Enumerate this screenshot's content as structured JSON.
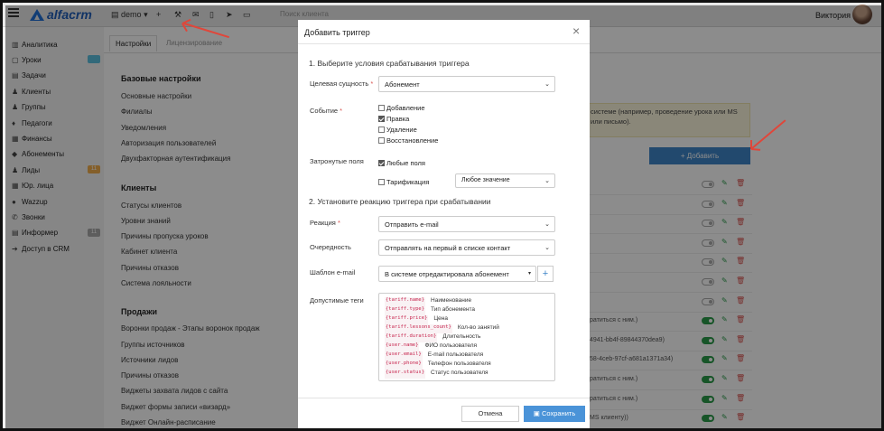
{
  "topbar": {
    "logo_text": "alfacrm",
    "branch": "demo",
    "search_placeholder": "Поиск клиента",
    "user_name": "Виктория"
  },
  "sidebar": {
    "items": [
      {
        "label": "Аналитика",
        "icon": "chart-icon"
      },
      {
        "label": "Уроки",
        "icon": "calendar-icon",
        "badge": "",
        "badge_color": "#5bc0de"
      },
      {
        "label": "Задачи",
        "icon": "tasks-icon"
      },
      {
        "label": "Клиенты",
        "icon": "user-icon"
      },
      {
        "label": "Группы",
        "icon": "users-icon"
      },
      {
        "label": "Педагоги",
        "icon": "graduation-icon"
      },
      {
        "label": "Финансы",
        "icon": "finance-icon"
      },
      {
        "label": "Абонементы",
        "icon": "tag-icon"
      },
      {
        "label": "Лиды",
        "icon": "lead-icon",
        "badge": "11",
        "badge_color": "#f0ad4e"
      },
      {
        "label": "Юр. лица",
        "icon": "building-icon"
      },
      {
        "label": "Wazzup",
        "icon": "whatsapp-icon"
      },
      {
        "label": "Звонки",
        "icon": "phone-icon"
      },
      {
        "label": "Информер",
        "icon": "informer-icon",
        "badge": "11",
        "badge_color": "#aaaaaa"
      },
      {
        "label": "Доступ в CRM",
        "icon": "login-icon"
      }
    ]
  },
  "settings": {
    "tabs": [
      "Настройки",
      "Лицензирование"
    ],
    "sections": [
      {
        "title": "Базовые настройки",
        "items": [
          "Основные настройки",
          "Филиалы",
          "Уведомления",
          "Авторизация пользователей",
          "Двухфакторная аутентификация"
        ]
      },
      {
        "title": "Клиенты",
        "items": [
          "Статусы клиентов",
          "Уровни знаний",
          "Причины пропуска уроков",
          "Кабинет клиента",
          "Причины отказов",
          "Система лояльности"
        ]
      },
      {
        "title": "Продажи",
        "items": [
          "Воронки продаж - Этапы воронок продаж",
          "Группы источников",
          "Источники лидов",
          "Причины отказов",
          "Виджеты захвата лидов с сайта",
          "Виджет формы записи «визард»",
          "Виджет Онлайн-расписание"
        ]
      }
    ],
    "info_text": "системе (например, проведение урока или МS или письмо).",
    "add_button": "+ Добавить",
    "rows": [
      {
        "text": "",
        "on": false
      },
      {
        "text": "",
        "on": false,
        "muted": true
      },
      {
        "text": "",
        "on": false
      },
      {
        "text": "",
        "on": false
      },
      {
        "text": "",
        "on": false
      },
      {
        "text": "",
        "on": false,
        "muted": true
      },
      {
        "text": "",
        "on": false
      },
      {
        "text": "ратиться с ним.)",
        "on": true
      },
      {
        "text": "4941-bb4f-89844370dea9)",
        "on": true
      },
      {
        "text": "58-4ceb-97cf-a681a1371a34)",
        "on": true
      },
      {
        "text": "ратиться с ним.)",
        "on": true
      },
      {
        "text": "ратиться с ним.)",
        "on": true
      },
      {
        "text": "MS клиенту))",
        "on": true
      },
      {
        "text": "84e2-4227-b950-4074520c47db)",
        "on": true
      }
    ]
  },
  "modal": {
    "title": "Добавить триггер",
    "section1": "1. Выберите условия срабатывания триггера",
    "target_label": "Целевая сущность",
    "target_value": "Абонемент",
    "event_label": "Событие",
    "events": [
      {
        "label": "Добавление",
        "checked": false
      },
      {
        "label": "Правка",
        "checked": true
      },
      {
        "label": "Удаление",
        "checked": false
      },
      {
        "label": "Восстановление",
        "checked": false
      }
    ],
    "fields_label": "Затронутые поля",
    "any_fields": {
      "label": "Любые поля",
      "checked": true
    },
    "tariff": {
      "label": "Тарификация",
      "checked": false
    },
    "tariff_value": "Любое значение",
    "section2": "2. Установите реакцию триггера при срабатывании",
    "reaction_label": "Реакция",
    "reaction_value": "Отправить e-mail",
    "order_label": "Очередность",
    "order_value": "Отправлять на первый в списке контакт",
    "template_label": "Шаблон e-mail",
    "template_value": "В системе отредактировала абонемент",
    "template_add": "+",
    "tags_label": "Допустимые теги",
    "tags": [
      {
        "code": "{tariff.name}",
        "desc": "Наименование"
      },
      {
        "code": "{tariff.type}",
        "desc": "Тип абонемента"
      },
      {
        "code": "{tariff.price}",
        "desc": "Цена"
      },
      {
        "code": "{tariff.lessons_count}",
        "desc": "Кол-во занятий"
      },
      {
        "code": "{tariff.duration}",
        "desc": "Длительность"
      },
      {
        "code": "{user.name}",
        "desc": "ФИО пользователя"
      },
      {
        "code": "{user.email}",
        "desc": "E-mail пользователя"
      },
      {
        "code": "{user.phone}",
        "desc": "Телефон пользователя"
      },
      {
        "code": "{user.status}",
        "desc": "Статус пользователя"
      }
    ],
    "cancel": "Отмена",
    "save": "Сохранить"
  },
  "colors": {
    "primary": "#4a93d8",
    "annotation_arrow": "#e0463a",
    "toggle_on": "#2b9b4a"
  }
}
